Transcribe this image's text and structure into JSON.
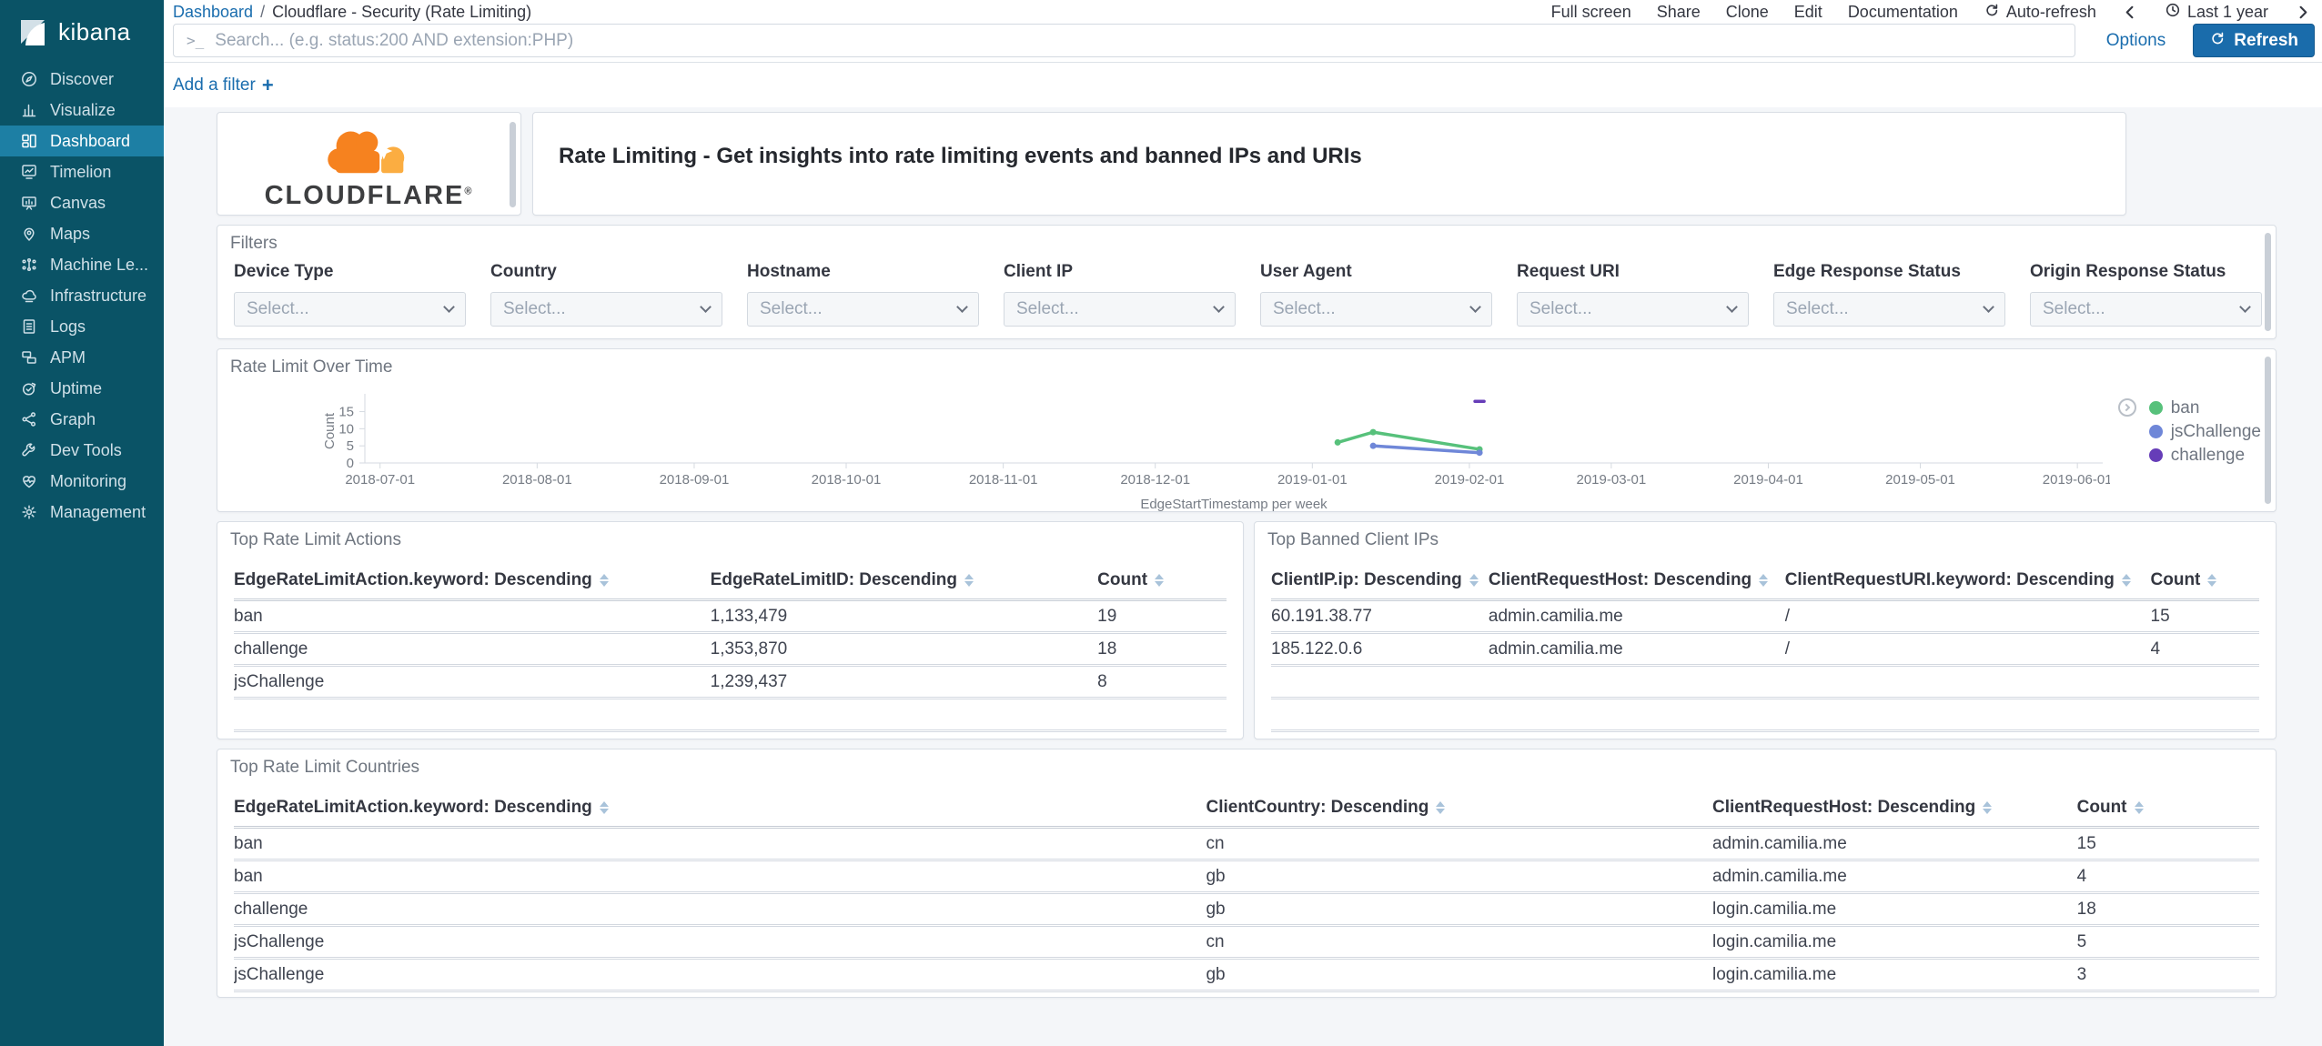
{
  "chrome": {
    "breadcrumb": {
      "root": "Dashboard",
      "separator": "/",
      "current": "Cloudflare - Security (Rate Limiting)"
    },
    "menu_items": [
      "Full screen",
      "Share",
      "Clone",
      "Edit",
      "Documentation"
    ],
    "auto_refresh_label": "Auto-refresh",
    "time_label": "Last 1 year",
    "search_placeholder": "Search... (e.g. status:200 AND extension:PHP)",
    "options_label": "Options",
    "refresh_label": "Refresh",
    "add_filter_label": "Add a filter",
    "link_color": "#1a6dae",
    "refresh_button_color": "#1a6cab"
  },
  "sidebar": {
    "logo_text": "kibana",
    "bg_color": "#0a5366",
    "active_color": "#1d7fa4",
    "items": [
      {
        "label": "Discover",
        "icon": "discover-icon",
        "active": false
      },
      {
        "label": "Visualize",
        "icon": "visualize-icon",
        "active": false
      },
      {
        "label": "Dashboard",
        "icon": "dashboard-icon",
        "active": true
      },
      {
        "label": "Timelion",
        "icon": "timelion-icon",
        "active": false
      },
      {
        "label": "Canvas",
        "icon": "canvas-icon",
        "active": false
      },
      {
        "label": "Maps",
        "icon": "maps-icon",
        "active": false
      },
      {
        "label": "Machine Le...",
        "icon": "machine-learning-icon",
        "active": false
      },
      {
        "label": "Infrastructure",
        "icon": "infrastructure-icon",
        "active": false
      },
      {
        "label": "Logs",
        "icon": "logs-icon",
        "active": false
      },
      {
        "label": "APM",
        "icon": "apm-icon",
        "active": false
      },
      {
        "label": "Uptime",
        "icon": "uptime-icon",
        "active": false
      },
      {
        "label": "Graph",
        "icon": "graph-icon",
        "active": false
      },
      {
        "label": "Dev Tools",
        "icon": "dev-tools-icon",
        "active": false
      },
      {
        "label": "Monitoring",
        "icon": "monitoring-icon",
        "active": false
      },
      {
        "label": "Management",
        "icon": "management-icon",
        "active": false
      }
    ]
  },
  "panels": {
    "logo_panel": {
      "brand": "CLOUDFLARE",
      "registered_mark": "®",
      "cloud_primary": "#f6821f",
      "cloud_secondary": "#fbad41"
    },
    "title_panel": {
      "text": "Rate Limiting - Get insights into rate limiting events and banned IPs and URIs"
    },
    "filters": {
      "title": "Filters",
      "select_placeholder": "Select...",
      "fields": [
        "Device Type",
        "Country",
        "Hostname",
        "Client IP",
        "User Agent",
        "Request URI",
        "Edge Response Status",
        "Origin Response Status"
      ]
    },
    "actions_table": {
      "title": "Top Rate Limit Actions",
      "columns": [
        "EdgeRateLimitAction.keyword: Descending",
        "EdgeRateLimitID: Descending",
        "Count"
      ],
      "rows": [
        [
          "ban",
          "1,133,479",
          "19"
        ],
        [
          "challenge",
          "1,353,870",
          "18"
        ],
        [
          "jsChallenge",
          "1,239,437",
          "8"
        ]
      ]
    },
    "banned_table": {
      "title": "Top Banned Client IPs",
      "columns": [
        "ClientIP.ip: Descending",
        "ClientRequestHost: Descending",
        "ClientRequestURI.keyword: Descending",
        "Count"
      ],
      "rows": [
        [
          "60.191.38.77",
          "admin.camilia.me",
          "/",
          "15"
        ],
        [
          "185.122.0.6",
          "admin.camilia.me",
          "/",
          "4"
        ]
      ]
    },
    "countries_table": {
      "title": "Top Rate Limit Countries",
      "columns": [
        "EdgeRateLimitAction.keyword: Descending",
        "ClientCountry: Descending",
        "ClientRequestHost: Descending",
        "Count"
      ],
      "rows": [
        [
          "ban",
          "cn",
          "admin.camilia.me",
          "15"
        ],
        [
          "ban",
          "gb",
          "admin.camilia.me",
          "4"
        ],
        [
          "challenge",
          "gb",
          "login.camilia.me",
          "18"
        ],
        [
          "jsChallenge",
          "cn",
          "login.camilia.me",
          "5"
        ],
        [
          "jsChallenge",
          "gb",
          "login.camilia.me",
          "3"
        ]
      ]
    }
  },
  "chart_data": {
    "type": "line",
    "title": "Rate Limit Over Time",
    "xlabel": "EdgeStartTimestamp per week",
    "ylabel": "Count",
    "x_domain": [
      "2018-06-28",
      "2019-06-06"
    ],
    "x_ticks": [
      "2018-07-01",
      "2018-08-01",
      "2018-09-01",
      "2018-10-01",
      "2018-11-01",
      "2018-12-01",
      "2019-01-01",
      "2019-02-01",
      "2019-03-01",
      "2019-04-01",
      "2019-05-01",
      "2019-06-01"
    ],
    "y_ticks": [
      0,
      5,
      10,
      15
    ],
    "ylim": [
      0,
      18.6
    ],
    "grid": false,
    "legend_position": "right",
    "series": [
      {
        "name": "ban",
        "color": "#57c17b",
        "points": [
          [
            "2019-01-06",
            6
          ],
          [
            "2019-01-13",
            9
          ],
          [
            "2019-02-03",
            4
          ]
        ]
      },
      {
        "name": "jsChallenge",
        "color": "#6f87d8",
        "points": [
          [
            "2019-01-13",
            5
          ],
          [
            "2019-02-03",
            3
          ]
        ]
      },
      {
        "name": "challenge",
        "color": "#663db8",
        "points": [
          [
            "2019-02-03",
            18
          ]
        ]
      }
    ]
  }
}
